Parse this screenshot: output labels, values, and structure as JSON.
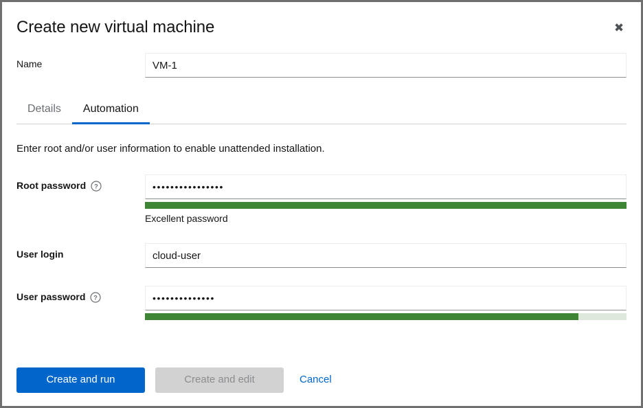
{
  "dialog": {
    "title": "Create new virtual machine",
    "close_icon": "close-icon",
    "close_label": "✖"
  },
  "name_field": {
    "label": "Name",
    "value": "VM-1",
    "placeholder": ""
  },
  "tabs": [
    {
      "label": "Details",
      "active": false
    },
    {
      "label": "Automation",
      "active": true
    }
  ],
  "description": "Enter root and/or user information to enable unattended installation.",
  "root_password": {
    "label": "Root password",
    "help_icon": "help-circle-icon",
    "value": "••••••••••••••••",
    "placeholder": "",
    "strength_percent": "100%",
    "strength_color": "#3e8635",
    "track_color": "#dce9db",
    "helper_text": "Excellent password"
  },
  "user_login": {
    "label": "User login",
    "value": "cloud-user",
    "placeholder": ""
  },
  "user_password": {
    "label": "User password",
    "help_icon": "help-circle-icon",
    "value": "••••••••••••••",
    "placeholder": "",
    "strength_percent": "90%",
    "strength_color": "#3e8635",
    "track_color": "#dce9db",
    "helper_text": ""
  },
  "footer": {
    "create_and_run_label": "Create and run",
    "create_and_edit_label": "Create and edit",
    "cancel_label": "Cancel",
    "primary_color": "#0066cc",
    "link_color": "#0066cc"
  }
}
